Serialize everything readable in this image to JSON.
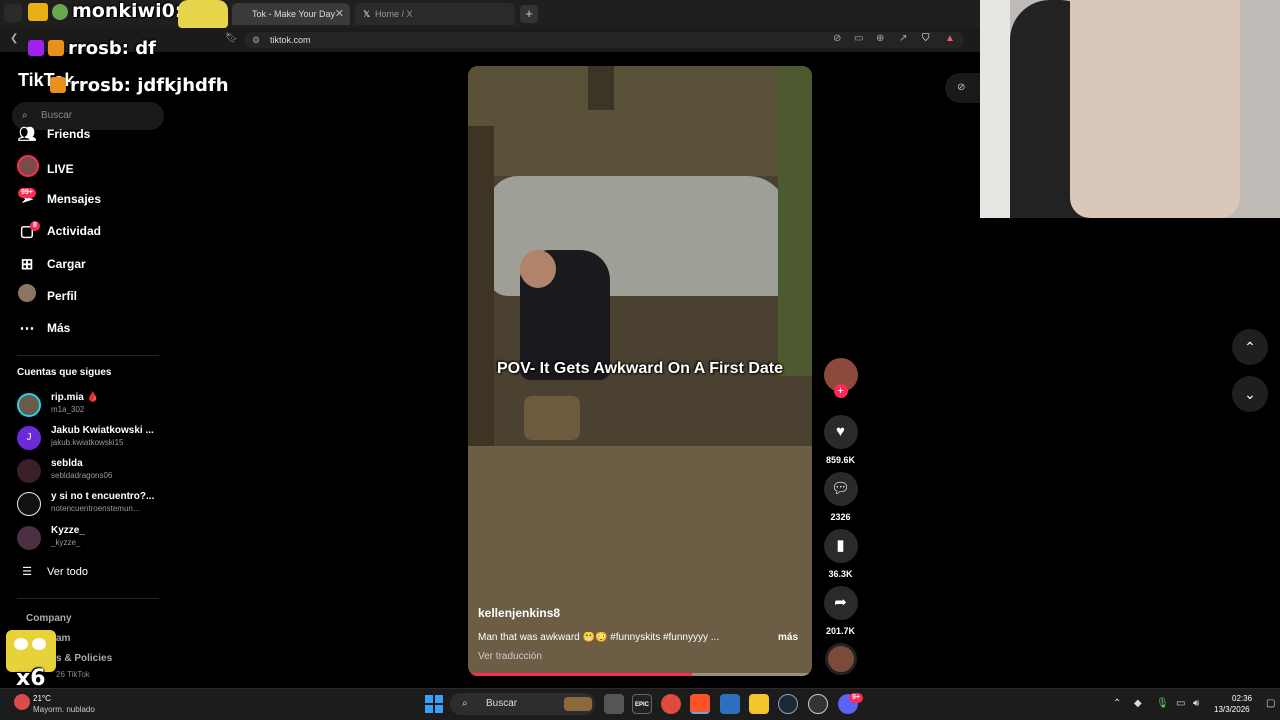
{
  "browser": {
    "tabs": [
      {
        "label": "Tok - Make Your Day",
        "active": true
      },
      {
        "label": "Home / X",
        "active": false
      }
    ],
    "url": "tiktok.com"
  },
  "overlay": {
    "username_title": "monkiwi0:",
    "chat": [
      {
        "user": "rrosb:",
        "message": "df"
      },
      {
        "user": "rrosb:",
        "message": "jdfkjhdfh"
      }
    ],
    "multiplier": "x6"
  },
  "logo_text": "TikTok",
  "search": {
    "placeholder": "Buscar"
  },
  "nav": [
    {
      "label": "Friends",
      "icon": "friends-icon"
    },
    {
      "label": "LIVE",
      "icon": "live-icon"
    },
    {
      "label": "Mensajes",
      "icon": "messages-icon",
      "badge": "99+"
    },
    {
      "label": "Actividad",
      "icon": "activity-icon",
      "badge": "8"
    },
    {
      "label": "Cargar",
      "icon": "upload-icon"
    },
    {
      "label": "Perfil",
      "icon": "profile-avatar"
    },
    {
      "label": "Más",
      "icon": "more-icon"
    }
  ],
  "following": {
    "title": "Cuentas que sigues",
    "accounts": [
      {
        "name": "rip.mia 🩸",
        "handle": "m1a_302"
      },
      {
        "name": "Jakub Kwiatkowski ...",
        "handle": "jakub.kwiatkowski15",
        "initial": "J"
      },
      {
        "name": "seblda",
        "handle": "sebldadragons06"
      },
      {
        "name": "y si no t encuentro?...",
        "handle": "notencuentroenstemun..."
      },
      {
        "name": "Kyzze_",
        "handle": "_kyzze_"
      }
    ],
    "see_all": "Ver todo"
  },
  "footer": {
    "company": "Company",
    "program": "am",
    "terms": "s & Policies",
    "copyright": "26 TikTok"
  },
  "video": {
    "caption": "POV- It Gets Awkward On A First Date",
    "author": "kellenjenkins8",
    "description": "Man that was awkward 😬😳 #funnyskits #funnyyyy ...",
    "more": "más",
    "translate": "Ver traducción",
    "progress": 0.65
  },
  "actions": {
    "likes": "859.6K",
    "comments": "2326",
    "saves": "36.3K",
    "shares": "201.7K"
  },
  "taskbar": {
    "search": "Buscar",
    "weather_temp": "21°C",
    "weather_desc": "Mayorm. nublado",
    "time": "02:36",
    "date": "13/3/2026",
    "discord_badge": "9+"
  },
  "colors": {
    "accent": "#fe2c55",
    "background": "#000000"
  }
}
